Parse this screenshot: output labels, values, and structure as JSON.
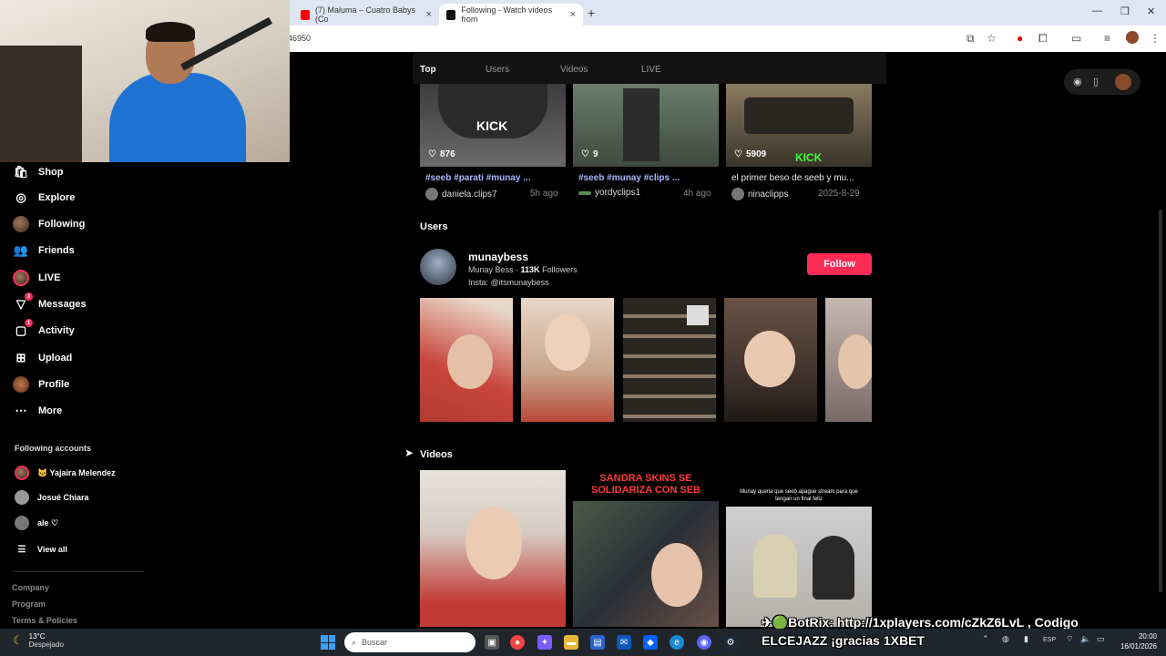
{
  "browser": {
    "tabs": [
      {
        "title": "(7) Maluma – Cuatro Babys (Co"
      },
      {
        "title": "Following - Watch videos from"
      }
    ],
    "url_fragment": "46950"
  },
  "sidebar": {
    "nav": [
      {
        "label": "Shop",
        "icon": "shop-icon"
      },
      {
        "label": "Explore",
        "icon": "compass-icon"
      },
      {
        "label": "Following",
        "icon": "avatar-icon"
      },
      {
        "label": "Friends",
        "icon": "friends-icon"
      },
      {
        "label": "LIVE",
        "icon": "live-icon"
      },
      {
        "label": "Messages",
        "icon": "messages-icon",
        "badge": "3"
      },
      {
        "label": "Activity",
        "icon": "activity-icon",
        "badge": "1"
      },
      {
        "label": "Upload",
        "icon": "upload-icon"
      },
      {
        "label": "Profile",
        "icon": "avatar-icon"
      },
      {
        "label": "More",
        "icon": "more-icon"
      }
    ],
    "following_title": "Following accounts",
    "accounts": [
      {
        "name": "🐱 Yajaira Melendez"
      },
      {
        "name": "Josué Chiara"
      },
      {
        "name": "ale ♡"
      }
    ],
    "view_all": "View all",
    "footer": [
      "Company",
      "Program",
      "Terms & Policies"
    ]
  },
  "search_tabs": [
    "Top",
    "Users",
    "Videos",
    "LIVE"
  ],
  "top_videos": [
    {
      "likes": "876",
      "title": "#seeb #parati #munay ...",
      "author": "daniela.clips7",
      "time": "5h ago"
    },
    {
      "likes": "9",
      "title": "#seeb #munay #clips ...",
      "author": "yordyclips1",
      "time": "4h ago"
    },
    {
      "likes": "5909",
      "title": "el primer beso de seeb y mu...",
      "author": "ninaclipps",
      "time": "2025-8-29"
    }
  ],
  "users_section": {
    "heading": "Users",
    "username": "munaybess",
    "display_name": "Munay Bess",
    "followers": "113K",
    "followers_label": "Followers",
    "separator": " · ",
    "bio": "Insta: @itsmunaybess",
    "follow_label": "Follow"
  },
  "videos_section": {
    "heading": "Videos",
    "thumb_captions": [
      "SANDRA SKINS SE SOLIDARIZA CON SEB",
      "Munay queria que seeb apague stream para que tengan un final feliz"
    ]
  },
  "thumb_overlays": {
    "kick1": "KICK",
    "kick3": "KICK"
  },
  "taskbar": {
    "weather_temp": "13°C",
    "weather_desc": "Despejado",
    "search_placeholder": "Buscar",
    "lang": "ESP",
    "time": "20:00",
    "date": "16/01/2026"
  },
  "stream_overlay": {
    "line1": "✈🟢BotRix: http://1xplayers.com/cZkZ6LvL , Codigo",
    "line2": "ELCEJAZZ ¡gracias 1XBET"
  },
  "colors": {
    "accent": "#fe2c55",
    "hashtag": "#aab8ff"
  }
}
